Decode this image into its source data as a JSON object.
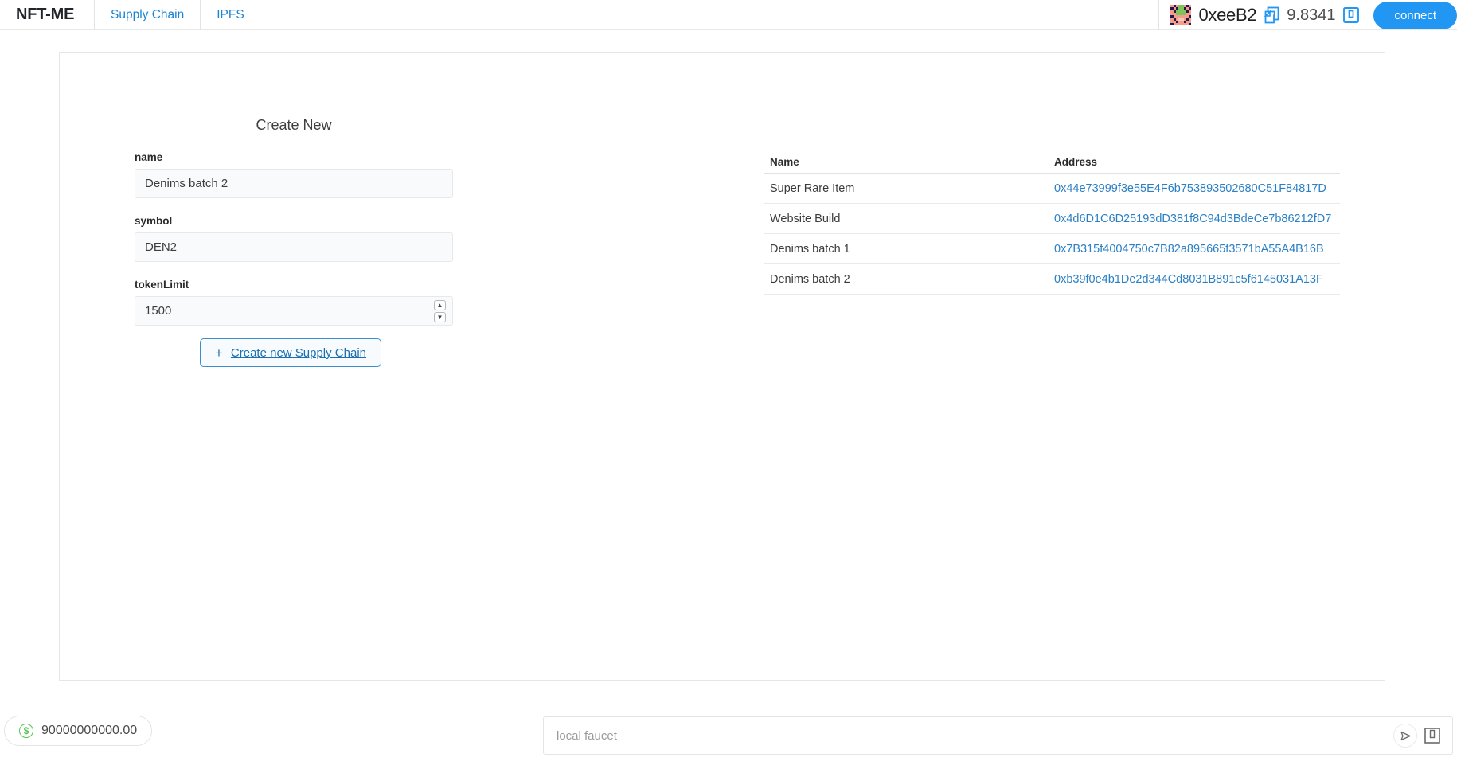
{
  "header": {
    "brand": "NFT-ME",
    "nav": [
      {
        "label": "Supply Chain",
        "name": "nav-supply-chain"
      },
      {
        "label": "IPFS",
        "name": "nav-ipfs"
      }
    ],
    "wallet": {
      "address": "0xeeB2",
      "balance": "9.8341",
      "connect_label": "connect",
      "copy_icon": "copy-icon",
      "save_icon": "save-icon",
      "avatar_icon": "blockie-avatar",
      "accent_color": "#2196f3"
    }
  },
  "main": {
    "panel_title": "Create New",
    "form": {
      "fields": [
        {
          "label": "name",
          "value": "Denims batch 2",
          "type": "text"
        },
        {
          "label": "symbol",
          "value": "DEN2",
          "type": "text"
        },
        {
          "label": "tokenLimit",
          "value": "1500",
          "type": "number"
        }
      ],
      "submit_label": "Create new Supply Chain",
      "submit_icon": "plus-icon"
    },
    "table": {
      "columns": [
        "Name",
        "Address"
      ],
      "rows": [
        {
          "name": "Super Rare Item",
          "address": "0x44e73999f3e55E4F6b753893502680C51F84817D"
        },
        {
          "name": "Website Build",
          "address": "0x4d6D1C6D25193dD381f8C94d3BdeCe7b86212fD7"
        },
        {
          "name": "Denims batch 1",
          "address": "0x7B315f4004750c7B82a895665f3571bA55A4B16B"
        },
        {
          "name": "Denims batch 2",
          "address": "0xb39f0e4b1De2d344Cd8031B891c5f6145031A13F"
        }
      ],
      "link_color": "#2b7fc4"
    }
  },
  "footer": {
    "balance_pill": {
      "amount": "90000000000.00",
      "icon": "dollar-circle-icon",
      "icon_color": "#56c456"
    },
    "faucet": {
      "placeholder": "local faucet",
      "value": "",
      "send_icon": "send-icon",
      "save_icon": "save-icon"
    }
  }
}
